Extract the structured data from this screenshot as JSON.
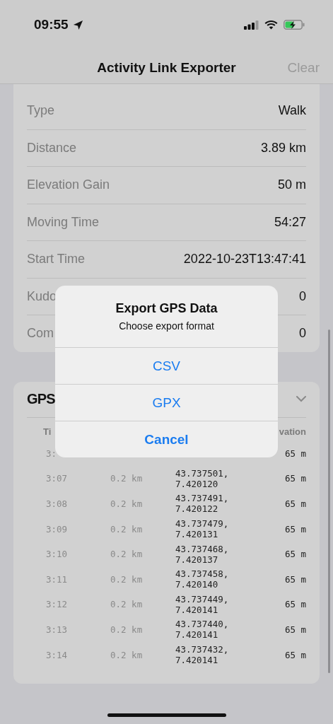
{
  "status_bar": {
    "time": "09:55"
  },
  "nav": {
    "title": "Activity Link Exporter",
    "action": {
      "label": "Clear",
      "disabled": true
    }
  },
  "details": [
    {
      "label": "Type",
      "value": "Walk"
    },
    {
      "label": "Distance",
      "value": "3.89 km"
    },
    {
      "label": "Elevation Gain",
      "value": "50 m"
    },
    {
      "label": "Moving Time",
      "value": "54:27"
    },
    {
      "label": "Start Time",
      "value": "2022-10-23T13:47:41"
    },
    {
      "label": "Kudo",
      "value": "0"
    },
    {
      "label": "Com",
      "value": "0"
    }
  ],
  "gps": {
    "title": "GPS",
    "expanded": true,
    "columns": [
      "Ti",
      "vation"
    ],
    "rows": [
      {
        "time": "3:",
        "elevation": "65 m"
      },
      {
        "time": "3:07",
        "distance": "0.2 km",
        "coordinates": "43.737501, 7.420120",
        "elevation": "65 m"
      },
      {
        "time": "3:08",
        "distance": "0.2 km",
        "coordinates": "43.737491, 7.420122",
        "elevation": "65 m"
      },
      {
        "time": "3:09",
        "distance": "0.2 km",
        "coordinates": "43.737479, 7.420131",
        "elevation": "65 m"
      },
      {
        "time": "3:10",
        "distance": "0.2 km",
        "coordinates": "43.737468, 7.420137",
        "elevation": "65 m"
      },
      {
        "time": "3:11",
        "distance": "0.2 km",
        "coordinates": "43.737458, 7.420140",
        "elevation": "65 m"
      },
      {
        "time": "3:12",
        "distance": "0.2 km",
        "coordinates": "43.737449, 7.420141",
        "elevation": "65 m"
      },
      {
        "time": "3:13",
        "distance": "0.2 km",
        "coordinates": "43.737440, 7.420141",
        "elevation": "65 m"
      },
      {
        "time": "3:14",
        "distance": "0.2 km",
        "coordinates": "43.737432, 7.420141",
        "elevation": "65 m"
      }
    ]
  },
  "dialog": {
    "title": "Export GPS Data",
    "message": "Choose export format",
    "actions": [
      {
        "label": "CSV",
        "kind": "default"
      },
      {
        "label": "GPX",
        "kind": "default"
      },
      {
        "label": "Cancel",
        "kind": "cancel"
      }
    ]
  }
}
